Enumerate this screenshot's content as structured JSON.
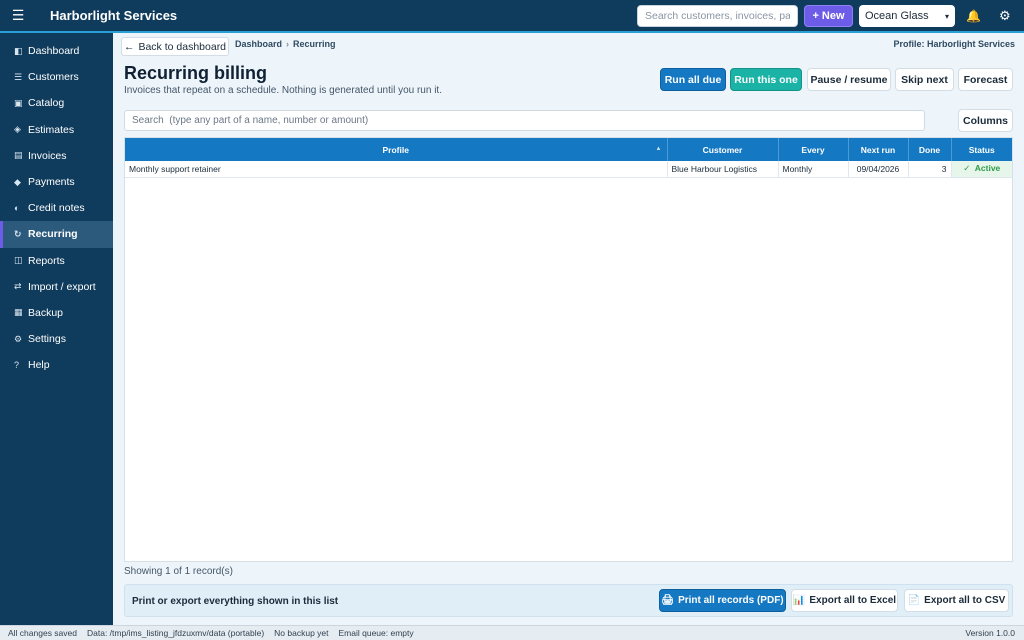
{
  "topbar": {
    "app_name": "Harborlight Services",
    "search_placeholder": "Search customers, invoices, pa...",
    "new_label": "New",
    "new_icon": "+",
    "theme_value": "Ocean Glass",
    "bell_icon": "🔔",
    "gear_icon": "⚙",
    "menu_icon": "☰"
  },
  "sidebar": {
    "items": [
      {
        "icon": "◧",
        "label": "Dashboard"
      },
      {
        "icon": "☰",
        "label": "Customers"
      },
      {
        "icon": "▣",
        "label": "Catalog"
      },
      {
        "icon": "◈",
        "label": "Estimates"
      },
      {
        "icon": "▤",
        "label": "Invoices"
      },
      {
        "icon": "◆",
        "label": "Payments"
      },
      {
        "icon": "◐",
        "label": "Credit notes"
      },
      {
        "icon": "↻",
        "label": "Recurring"
      },
      {
        "icon": "◫",
        "label": "Reports"
      },
      {
        "icon": "⇄",
        "label": "Import / export"
      },
      {
        "icon": "▦",
        "label": "Backup"
      },
      {
        "icon": "⚙",
        "label": "Settings"
      },
      {
        "icon": "?",
        "label": "Help"
      }
    ],
    "active": "Recurring"
  },
  "header": {
    "back_label": "Back to dashboard",
    "back_icon": "←",
    "breadcrumb": [
      "Dashboard",
      "Recurring"
    ],
    "breadcrumb_sep": "›",
    "profile": "Profile: Harborlight Services"
  },
  "page": {
    "title": "Recurring billing",
    "subtitle": "Invoices that repeat on a schedule. Nothing is generated until you run it."
  },
  "actions": {
    "run_all_due": "Run all due",
    "run_this_one": "Run this one",
    "pause_resume": "Pause / resume",
    "skip_next": "Skip next",
    "forecast": "Forecast"
  },
  "list": {
    "search_placeholder": "Search  (type any part of a name, number or amount)",
    "columns_label": "Columns",
    "headers": [
      "Profile",
      "Customer",
      "Every",
      "Next run",
      "Done",
      "Status"
    ],
    "rows": [
      {
        "profile": "Monthly support retainer",
        "customer": "Blue Harbour Logistics",
        "every": "Monthly",
        "next_run": "09/04/2026",
        "done": "3",
        "status": "Active",
        "status_icon": "✓"
      }
    ],
    "showing": "Showing 1 of 1 record(s)"
  },
  "footer": {
    "label": "Print or export everything shown in this list",
    "print_label": "Print all records (PDF)",
    "print_icon": "🖨",
    "excel_label": "Export all to Excel",
    "excel_icon": "📊",
    "csv_label": "Export all to CSV",
    "csv_icon": "📄"
  },
  "statusbar": {
    "saved": "All changes saved",
    "data_path": "Data: /tmp/ims_listing_jfdzuxmv/data  (portable)",
    "backup": "No backup yet",
    "email_queue": "Email queue: empty",
    "version": "Version 1.0.0"
  },
  "colors": {
    "brand": "#0f3b5c",
    "accent": "#6c5ce7",
    "primary": "#1478c2",
    "teal": "#1ab3a6",
    "active_status": "#2e9a47"
  }
}
